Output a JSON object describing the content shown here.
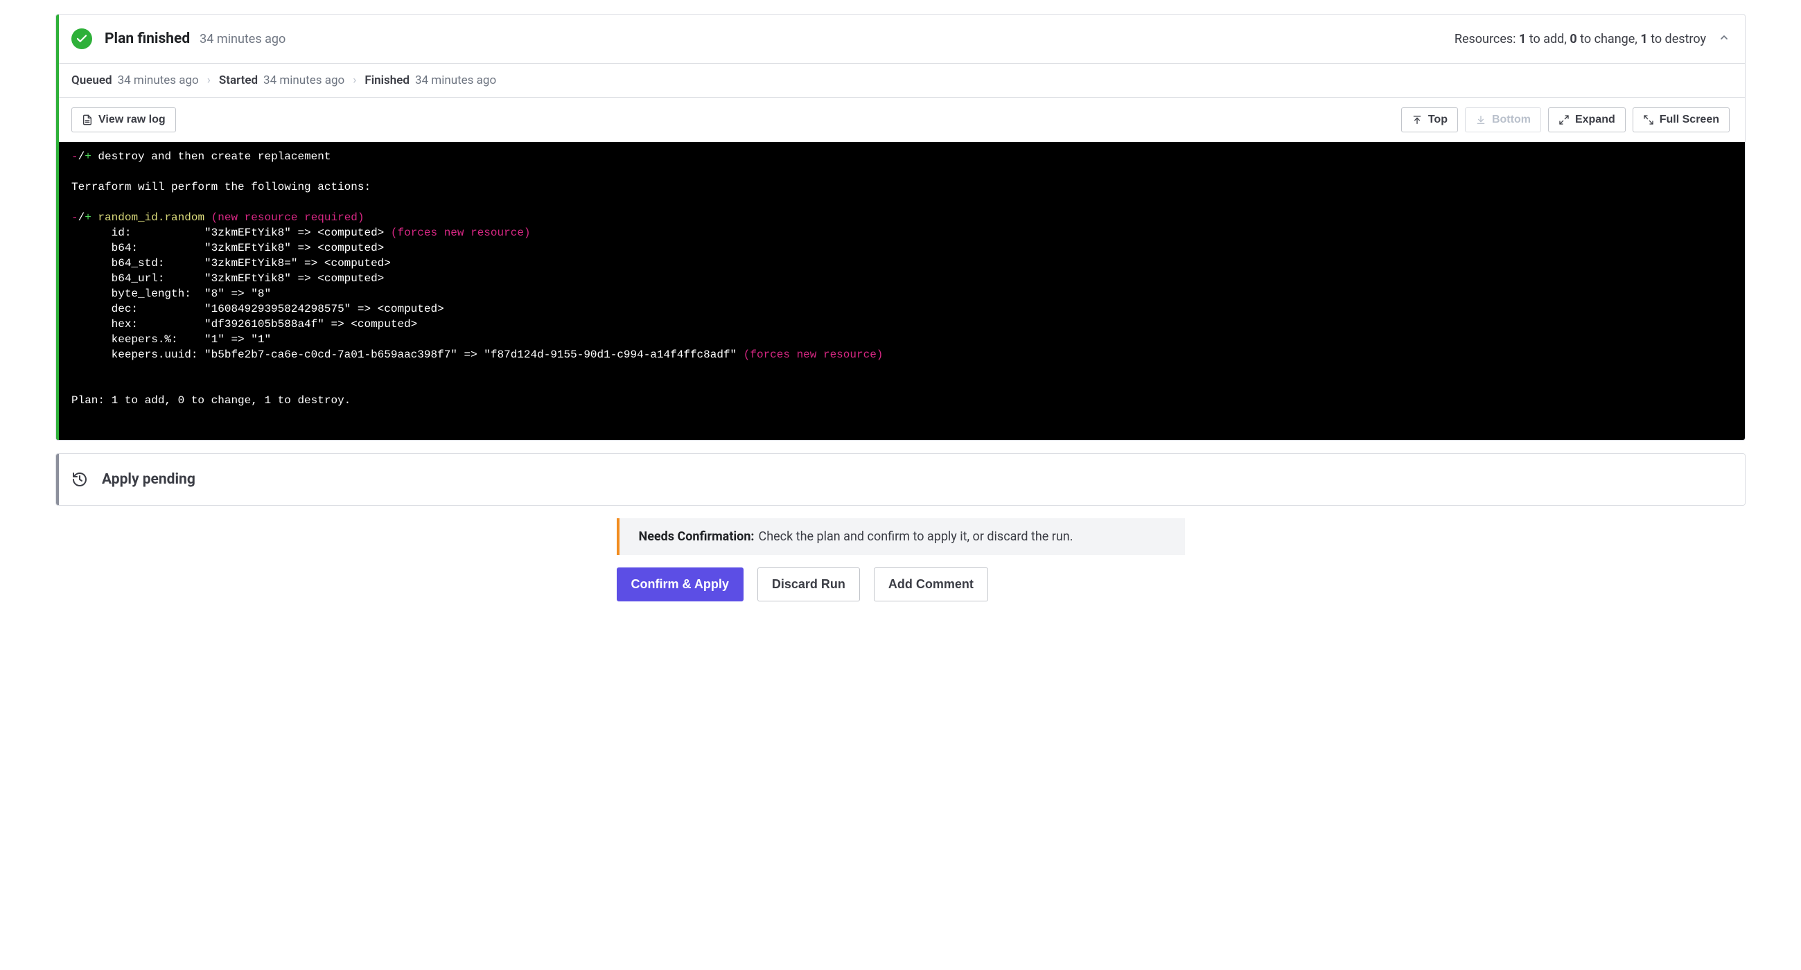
{
  "plan": {
    "title": "Plan finished",
    "time": "34 minutes ago",
    "resources_prefix": "Resources: ",
    "to_add": "1",
    "add_label": " to add, ",
    "to_change": "0",
    "change_label": " to change, ",
    "to_destroy": "1",
    "destroy_label": " to destroy",
    "timeline": {
      "queued": {
        "label": "Queued",
        "time": "34 minutes ago"
      },
      "started": {
        "label": "Started",
        "time": "34 minutes ago"
      },
      "finished": {
        "label": "Finished",
        "time": "34 minutes ago"
      }
    },
    "toolbar": {
      "view_raw": "View raw log",
      "top": "Top",
      "bottom": "Bottom",
      "expand": "Expand",
      "full_screen": "Full Screen"
    },
    "log": {
      "l1_pre": "-",
      "l1_mid": "/",
      "l1_post": "+",
      "l1_text": " destroy and then create replacement",
      "l2": "Terraform will perform the following actions:",
      "l3_pre": "-",
      "l3_mid": "/",
      "l3_post": "+",
      "l3_name": " random_id.random",
      "l3_paren": " (new resource required)",
      "r_id": "      id:           \"3zkmEFtYik8\" => <computed>",
      "r_id_force": " (forces new resource)",
      "r_b64": "      b64:          \"3zkmEFtYik8\" => <computed>",
      "r_b64_std": "      b64_std:      \"3zkmEFtYik8=\" => <computed>",
      "r_b64_url": "      b64_url:      \"3zkmEFtYik8\" => <computed>",
      "r_byte_length": "      byte_length:  \"8\" => \"8\"",
      "r_dec": "      dec:          \"16084929395824298575\" => <computed>",
      "r_hex": "      hex:          \"df3926105b588a4f\" => <computed>",
      "r_keepers_pct": "      keepers.%:    \"1\" => \"1\"",
      "r_keepers_uuid": "      keepers.uuid: \"b5bfe2b7-ca6e-c0cd-7a01-b659aac398f7\" => \"f87d124d-9155-90d1-c994-a14f4ffc8adf\"",
      "r_keepers_force": " (forces new resource)",
      "summary": "Plan: 1 to add, 0 to change, 1 to destroy."
    }
  },
  "apply": {
    "title": "Apply pending"
  },
  "confirm": {
    "alert_title": "Needs Confirmation:",
    "alert_text": " Check the plan and confirm to apply it, or discard the run.",
    "confirm_apply": "Confirm & Apply",
    "discard": "Discard Run",
    "add_comment": "Add Comment"
  }
}
